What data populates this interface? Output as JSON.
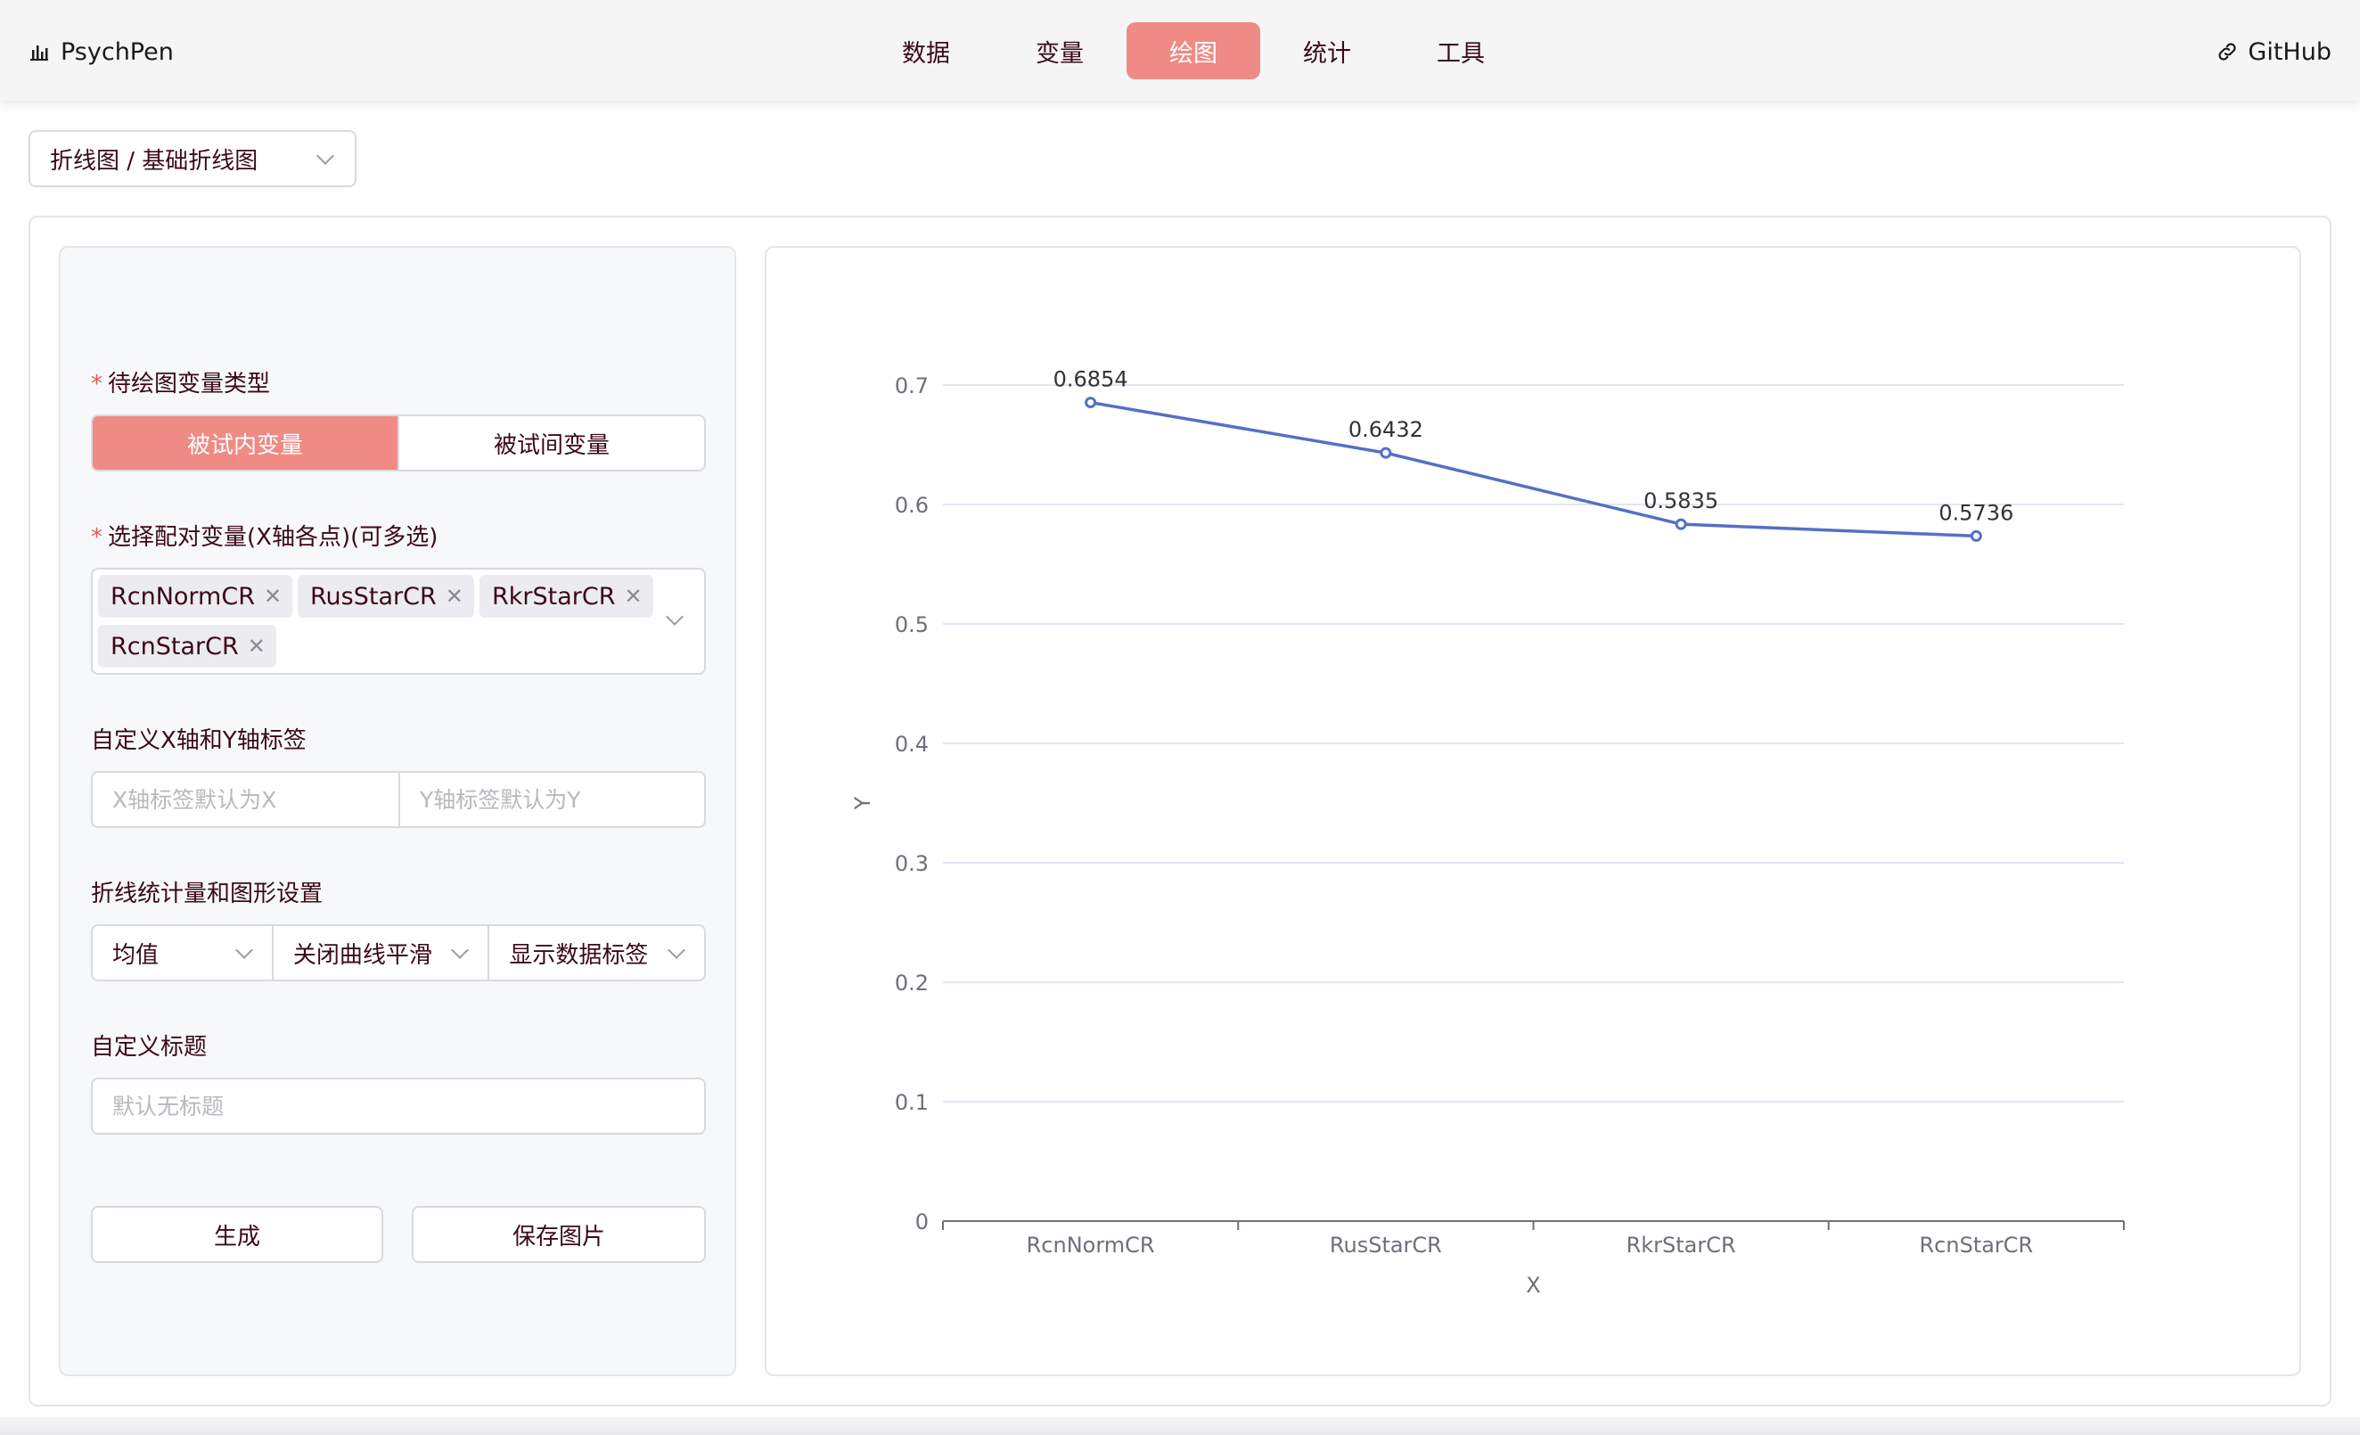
{
  "header": {
    "brand": "PsychPen",
    "nav": [
      "数据",
      "变量",
      "绘图",
      "统计",
      "工具"
    ],
    "active_nav": "绘图",
    "github": "GitHub"
  },
  "chart_type_select": "折线图 / 基础折线图",
  "form": {
    "var_type_label": "待绘图变量类型",
    "var_type_options": [
      "被试内变量",
      "被试间变量"
    ],
    "var_type_selected": "被试内变量",
    "paired_label": "选择配对变量(X轴各点)(可多选)",
    "paired_tags": [
      "RcnNormCR",
      "RusStarCR",
      "RkrStarCR",
      "RcnStarCR"
    ],
    "axis_label_title": "自定义X轴和Y轴标签",
    "x_placeholder": "X轴标签默认为X",
    "y_placeholder": "Y轴标签默认为Y",
    "settings_label": "折线统计量和图形设置",
    "settings": [
      "均值",
      "关闭曲线平滑",
      "显示数据标签"
    ],
    "title_label": "自定义标题",
    "title_placeholder": "默认无标题",
    "generate_button": "生成",
    "save_button": "保存图片"
  },
  "icons": {
    "brand": "bar-chart-icon",
    "github": "link-icon",
    "remove_tag": "close-icon",
    "dropdown": "chevron-down-icon"
  },
  "colors": {
    "accent": "#ef8a85",
    "line": "#5470c6"
  },
  "chart_data": {
    "type": "line",
    "categories": [
      "RcnNormCR",
      "RusStarCR",
      "RkrStarCR",
      "RcnStarCR"
    ],
    "values": [
      0.6854,
      0.6432,
      0.5835,
      0.5736
    ],
    "data_labels": [
      "0.6854",
      "0.6432",
      "0.5835",
      "0.5736"
    ],
    "xlabel": "X",
    "ylabel": "Y",
    "ylim": [
      0,
      0.7
    ],
    "yticks": [
      "0",
      "0.1",
      "0.2",
      "0.3",
      "0.4",
      "0.5",
      "0.6",
      "0.7"
    ],
    "grid": true
  }
}
